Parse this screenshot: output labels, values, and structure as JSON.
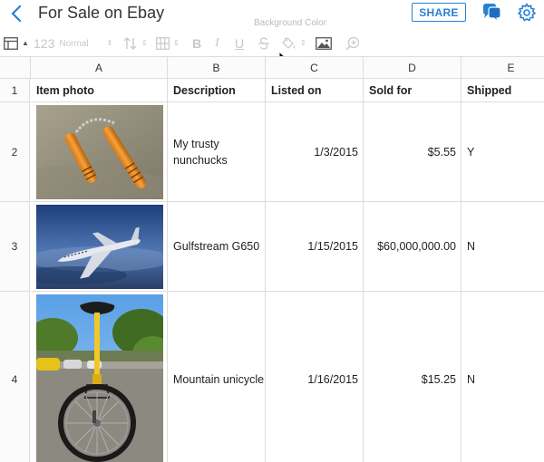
{
  "header": {
    "title": "For Sale on Ebay",
    "share_label": "SHARE"
  },
  "toolbar": {
    "tooltip": "Background Color",
    "number_format": "123",
    "style_label": "Normal",
    "bold": "B",
    "italic": "I",
    "underline": "U"
  },
  "sheet": {
    "columns": [
      "A",
      "B",
      "C",
      "D",
      "E"
    ],
    "row_numbers": [
      "1",
      "2",
      "3",
      "4"
    ],
    "headers": {
      "a": "Item photo",
      "b": "Description",
      "c": "Listed on",
      "d": "Sold for",
      "e": "Shipped"
    },
    "rows": [
      {
        "description": "My trusty nunchucks",
        "listed_on": "1/3/2015",
        "sold_for": "$5.55",
        "shipped": "Y"
      },
      {
        "description": "Gulfstream G650",
        "listed_on": "1/15/2015",
        "sold_for": "$60,000,000.00",
        "shipped": "N"
      },
      {
        "description": "Mountain unicycle",
        "listed_on": "1/16/2015",
        "sold_for": "$15.25",
        "shipped": "N"
      }
    ]
  },
  "colors": {
    "accent": "#2a7fd4",
    "gridline": "#dcdcdc",
    "toolbar_icon": "#c8c8c8"
  },
  "icons": [
    "back-arrow-icon",
    "comment-icon",
    "gear-icon",
    "table-layout-icon",
    "sort-icon",
    "borders-icon",
    "strikethrough-icon",
    "fill-color-icon",
    "insert-image-icon",
    "zoom-icon"
  ]
}
